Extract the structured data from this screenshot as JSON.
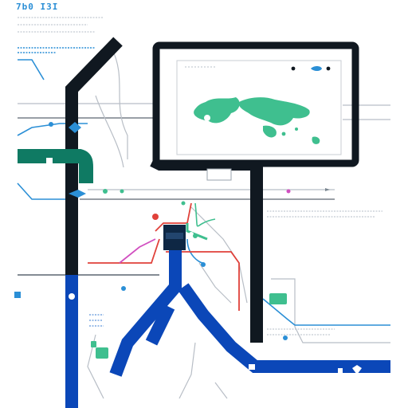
{
  "header": {
    "title": "7b0 I3I"
  },
  "colors": {
    "background": "#ffffff",
    "dark_line": "#101820",
    "blue_line": "#0b47b8",
    "green_line": "#0f7a63",
    "red_line": "#e0413a",
    "magenta_line": "#d14fc0",
    "light_blue_line": "#2b8fd6",
    "grey_line": "#b8bec6",
    "map_land": "#3fbf8f",
    "screen_frame": "#101820",
    "screen_fill": "#ffffff"
  },
  "icons": [
    "station-icon",
    "world-map-icon",
    "screen-frame",
    "legend-swatch"
  ]
}
